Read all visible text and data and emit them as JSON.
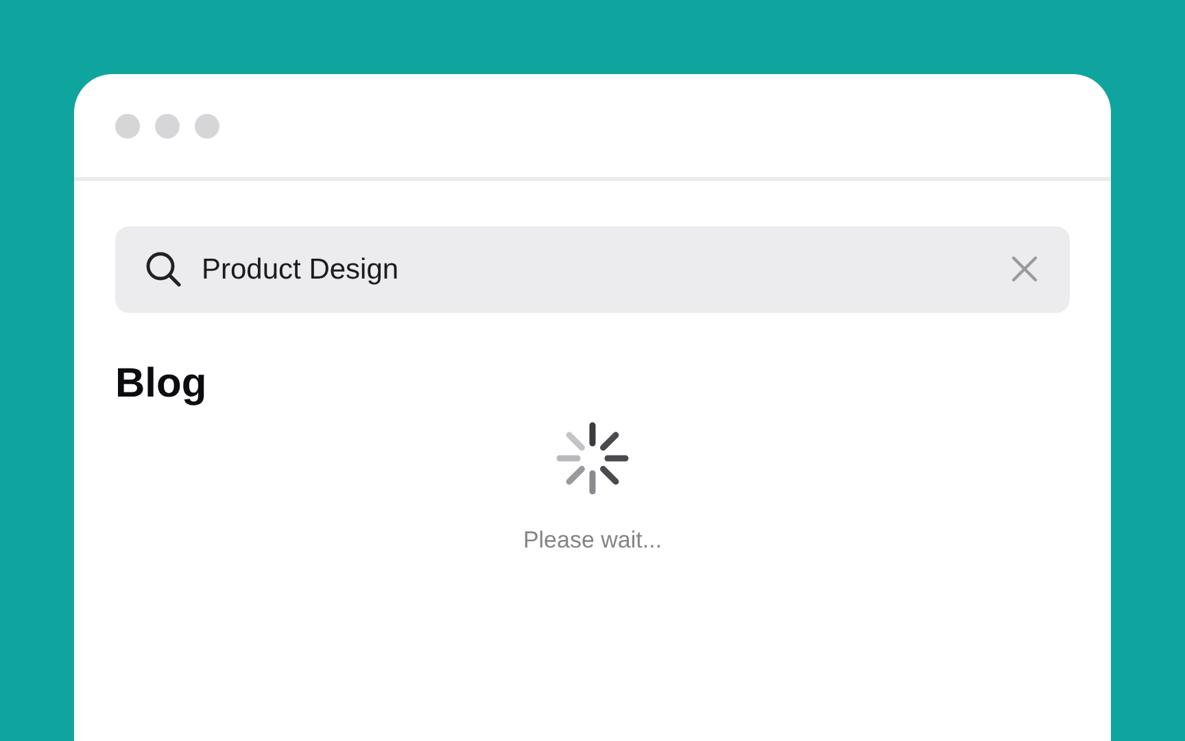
{
  "search": {
    "value": "Product Design"
  },
  "section": {
    "title": "Blog"
  },
  "loading": {
    "message": "Please wait..."
  }
}
